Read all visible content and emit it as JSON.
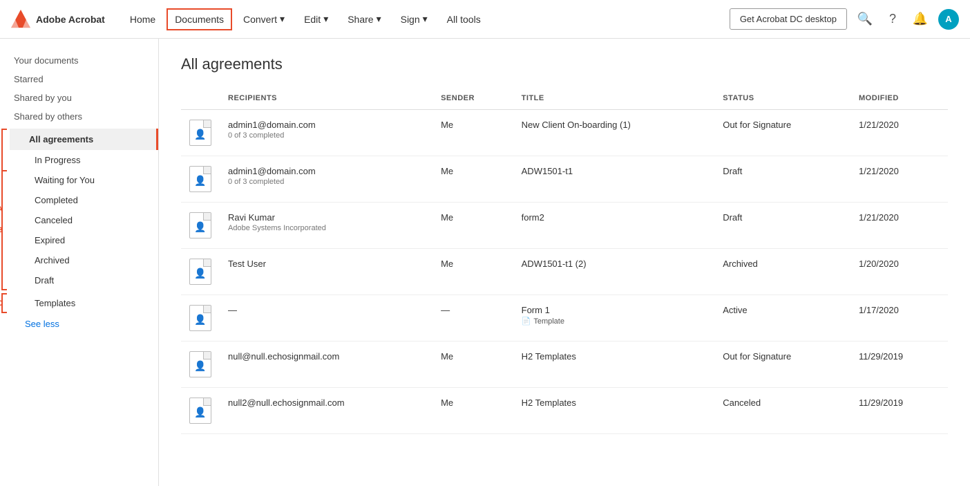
{
  "app": {
    "logo_text": "Adobe Acrobat",
    "get_desktop_label": "Get Acrobat DC desktop"
  },
  "nav": {
    "items": [
      {
        "id": "home",
        "label": "Home"
      },
      {
        "id": "documents",
        "label": "Documents",
        "active": true
      },
      {
        "id": "convert",
        "label": "Convert",
        "has_arrow": true
      },
      {
        "id": "edit",
        "label": "Edit",
        "has_arrow": true
      },
      {
        "id": "share",
        "label": "Share",
        "has_arrow": true
      },
      {
        "id": "sign",
        "label": "Sign",
        "has_arrow": true
      },
      {
        "id": "all_tools",
        "label": "All tools"
      }
    ]
  },
  "sidebar": {
    "your_documents_label": "Your documents",
    "starred_label": "Starred",
    "shared_by_you_label": "Shared by you",
    "shared_by_others_label": "Shared by others",
    "group_a_label": "A",
    "all_agreements_label": "All agreements",
    "sub_items": [
      {
        "id": "in_progress",
        "label": "In Progress"
      },
      {
        "id": "waiting_for_you",
        "label": "Waiting for You"
      },
      {
        "id": "completed",
        "label": "Completed"
      },
      {
        "id": "canceled",
        "label": "Canceled"
      },
      {
        "id": "expired",
        "label": "Expired"
      },
      {
        "id": "archived",
        "label": "Archived"
      },
      {
        "id": "draft",
        "label": "Draft"
      }
    ],
    "group_b_label": "B",
    "group_c_label": "C",
    "templates_label": "Templates",
    "see_less_label": "See less"
  },
  "main": {
    "page_title": "All agreements",
    "table": {
      "columns": [
        {
          "id": "icon",
          "label": ""
        },
        {
          "id": "recipients",
          "label": "Recipients"
        },
        {
          "id": "sender",
          "label": "Sender"
        },
        {
          "id": "title",
          "label": "Title"
        },
        {
          "id": "status",
          "label": "Status"
        },
        {
          "id": "modified",
          "label": "Modified"
        }
      ],
      "rows": [
        {
          "id": 1,
          "recipient_name": "admin1@domain.com",
          "recipient_sub": "0 of 3 completed",
          "sender": "Me",
          "title": "New Client On-boarding (1)",
          "status": "Out for Signature",
          "modified": "1/21/2020"
        },
        {
          "id": 2,
          "recipient_name": "admin1@domain.com",
          "recipient_sub": "0 of 3 completed",
          "sender": "Me",
          "title": "ADW1501-t1",
          "status": "Draft",
          "modified": "1/21/2020"
        },
        {
          "id": 3,
          "recipient_name": "Ravi Kumar",
          "recipient_sub": "Adobe Systems Incorporated",
          "sender": "Me",
          "title": "form2",
          "status": "Draft",
          "modified": "1/21/2020"
        },
        {
          "id": 4,
          "recipient_name": "Test User",
          "recipient_sub": "",
          "sender": "Me",
          "title": "ADW1501-t1 (2)",
          "status": "Archived",
          "modified": "1/20/2020"
        },
        {
          "id": 5,
          "recipient_name": "—",
          "recipient_sub": "",
          "sender": "—",
          "title": "Form 1",
          "title_badge": "Template",
          "status": "Active",
          "modified": "1/17/2020"
        },
        {
          "id": 6,
          "recipient_name": "null@null.echosignmail.com",
          "recipient_sub": "",
          "sender": "Me",
          "title": "H2 Templates",
          "status": "Out for Signature",
          "modified": "11/29/2019"
        },
        {
          "id": 7,
          "recipient_name": "null2@null.echosignmail.com",
          "recipient_sub": "",
          "sender": "Me",
          "title": "H2 Templates",
          "status": "Canceled",
          "modified": "11/29/2019"
        }
      ]
    }
  }
}
